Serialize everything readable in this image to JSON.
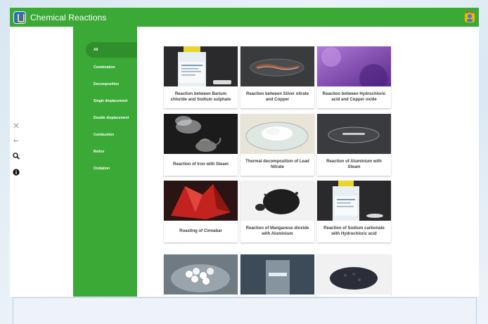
{
  "app": {
    "title": "Chemical Reactions"
  },
  "toolbar": {
    "tools": [
      {
        "name": "close-icon",
        "glyph": "✕"
      },
      {
        "name": "back-arrow-icon",
        "glyph": "←"
      },
      {
        "name": "search-icon",
        "glyph": "⚲"
      },
      {
        "name": "info-icon",
        "glyph": "●"
      }
    ]
  },
  "sidebar": {
    "items": [
      {
        "label": "All",
        "active": true
      },
      {
        "label": "Combination",
        "active": false
      },
      {
        "label": "Decomposition",
        "active": false
      },
      {
        "label": "Single displacement",
        "active": false
      },
      {
        "label": "Double displacement",
        "active": false
      },
      {
        "label": "Combustion",
        "active": false
      },
      {
        "label": "Redox",
        "active": false
      },
      {
        "label": "Oxidation",
        "active": false
      }
    ]
  },
  "cards": [
    {
      "caption": "Reaction between Barium chloride and Sodium sulphate",
      "image": "reagent-bottle-photo"
    },
    {
      "caption": "Reaction between Silver nitrate and Copper",
      "image": "copper-wire-in-dish-photo"
    },
    {
      "caption": "Reaction between Hydrochloric acid and Copper oxide",
      "image": "purple-powder-photo"
    },
    {
      "caption": "Reaction of Iron with Steam",
      "image": "steaming-kettle-photo"
    },
    {
      "caption": "Thermal decomposition of Lead Nitrate",
      "image": "white-crystals-photo"
    },
    {
      "caption": "Reaction of Aluminium with Steam",
      "image": "glass-dish-photo"
    },
    {
      "caption": "Roasting of Cinnabar",
      "image": "red-crystal-photo"
    },
    {
      "caption": "Reaction of Manganese dioxide with Aluminium",
      "image": "black-powder-photo"
    },
    {
      "caption": "Reaction of Sodium carbonate with Hydrochloric acid",
      "image": "reagent-bottle-photo"
    },
    {
      "caption": "",
      "image": "white-pellets-photo"
    },
    {
      "caption": "",
      "image": "flask-photo"
    },
    {
      "caption": "",
      "image": "dark-granules-photo"
    }
  ],
  "colors": {
    "primary_green": "#3aa935",
    "active_nav": "#2f8f2a",
    "card_caption": "#3b3b3b"
  }
}
